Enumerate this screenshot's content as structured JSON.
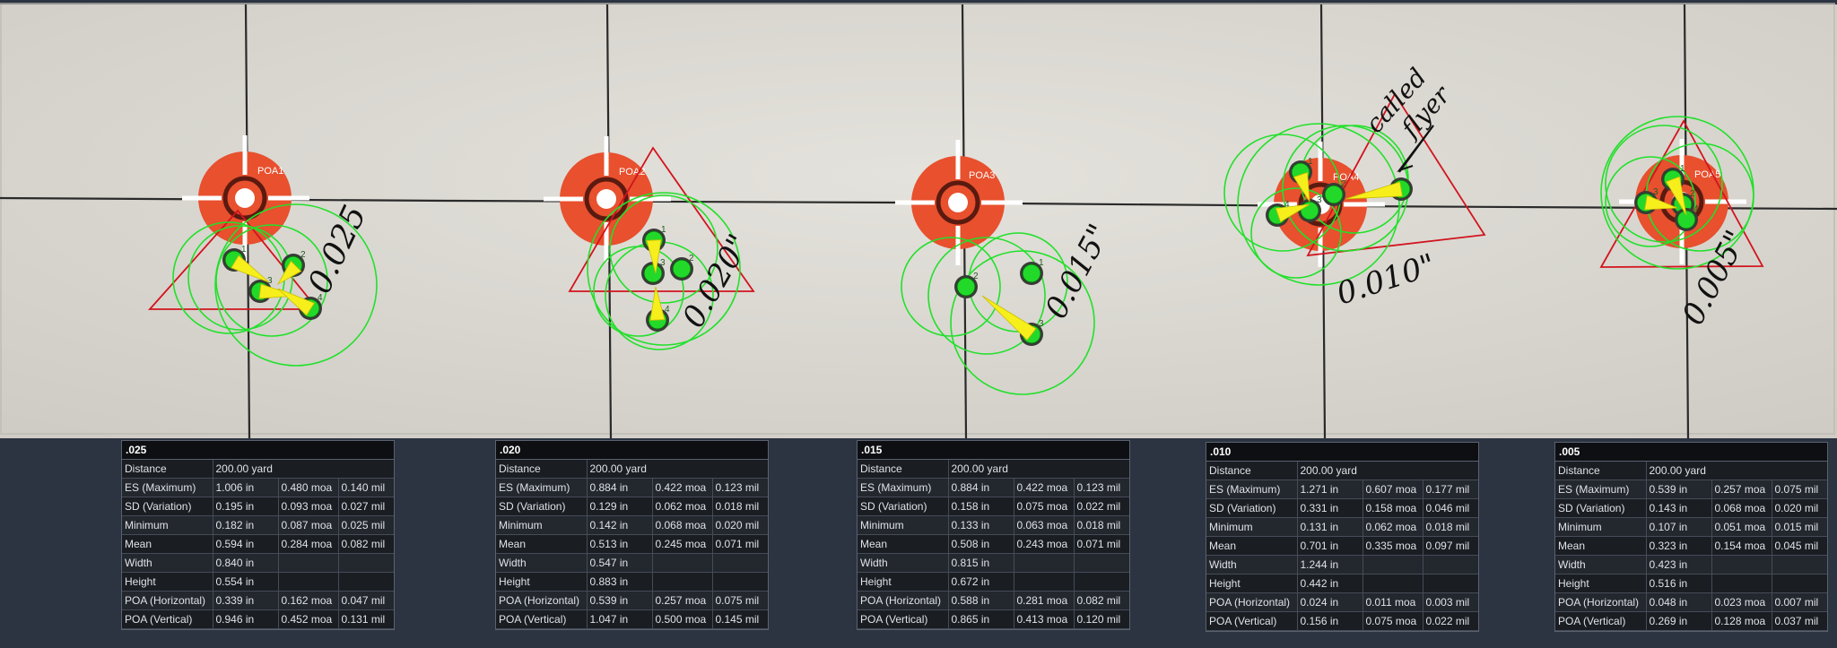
{
  "photo": {
    "targets": [
      {
        "poa_label": "POA1",
        "group_label": "0.025",
        "shot_numbers": [
          "1",
          "2",
          "3",
          "4"
        ]
      },
      {
        "poa_label": "POA2",
        "group_label": "0.020\"",
        "shot_numbers": [
          "1",
          "2",
          "3",
          "4"
        ]
      },
      {
        "poa_label": "POA3",
        "group_label": "0.015\"",
        "shot_numbers": [
          "1",
          "2",
          "3"
        ]
      },
      {
        "poa_label": "POA4",
        "group_label": "0.010\"",
        "shot_numbers": [
          "1",
          "2",
          "3",
          "4"
        ],
        "note": "called flyer"
      },
      {
        "poa_label": "POA5",
        "group_label": "0.005\"",
        "shot_numbers": [
          "1",
          "2",
          "3",
          "4"
        ]
      }
    ]
  },
  "panels": [
    {
      "title": ".025",
      "rows": [
        [
          "Distance",
          "200.00 yard"
        ],
        [
          "ES (Maximum)",
          "1.006 in",
          "0.480 moa",
          "0.140 mil"
        ],
        [
          "SD (Variation)",
          "0.195 in",
          "0.093 moa",
          "0.027 mil"
        ],
        [
          "Minimum",
          "0.182 in",
          "0.087 moa",
          "0.025 mil"
        ],
        [
          "Mean",
          "0.594 in",
          "0.284 moa",
          "0.082 mil"
        ],
        [
          "Width",
          "0.840 in"
        ],
        [
          "Height",
          "0.554 in"
        ],
        [
          "POA (Horizontal)",
          "0.339 in",
          "0.162 moa",
          "0.047 mil"
        ],
        [
          "POA (Vertical)",
          "0.946 in",
          "0.452 moa",
          "0.131 mil"
        ]
      ]
    },
    {
      "title": ".020",
      "rows": [
        [
          "Distance",
          "200.00 yard"
        ],
        [
          "ES (Maximum)",
          "0.884 in",
          "0.422 moa",
          "0.123 mil"
        ],
        [
          "SD (Variation)",
          "0.129 in",
          "0.062 moa",
          "0.018 mil"
        ],
        [
          "Minimum",
          "0.142 in",
          "0.068 moa",
          "0.020 mil"
        ],
        [
          "Mean",
          "0.513 in",
          "0.245 moa",
          "0.071 mil"
        ],
        [
          "Width",
          "0.547 in"
        ],
        [
          "Height",
          "0.883 in"
        ],
        [
          "POA (Horizontal)",
          "0.539 in",
          "0.257 moa",
          "0.075 mil"
        ],
        [
          "POA (Vertical)",
          "1.047 in",
          "0.500 moa",
          "0.145 mil"
        ]
      ]
    },
    {
      "title": ".015",
      "rows": [
        [
          "Distance",
          "200.00 yard"
        ],
        [
          "ES (Maximum)",
          "0.884 in",
          "0.422 moa",
          "0.123 mil"
        ],
        [
          "SD (Variation)",
          "0.158 in",
          "0.075 moa",
          "0.022 mil"
        ],
        [
          "Minimum",
          "0.133 in",
          "0.063 moa",
          "0.018 mil"
        ],
        [
          "Mean",
          "0.508 in",
          "0.243 moa",
          "0.071 mil"
        ],
        [
          "Width",
          "0.815 in"
        ],
        [
          "Height",
          "0.672 in"
        ],
        [
          "POA (Horizontal)",
          "0.588 in",
          "0.281 moa",
          "0.082 mil"
        ],
        [
          "POA (Vertical)",
          "0.865 in",
          "0.413 moa",
          "0.120 mil"
        ]
      ]
    },
    {
      "title": ".010",
      "rows": [
        [
          "Distance",
          "200.00 yard"
        ],
        [
          "ES (Maximum)",
          "1.271 in",
          "0.607 moa",
          "0.177 mil"
        ],
        [
          "SD (Variation)",
          "0.331 in",
          "0.158 moa",
          "0.046 mil"
        ],
        [
          "Minimum",
          "0.131 in",
          "0.062 moa",
          "0.018 mil"
        ],
        [
          "Mean",
          "0.701 in",
          "0.335 moa",
          "0.097 mil"
        ],
        [
          "Width",
          "1.244 in"
        ],
        [
          "Height",
          "0.442 in"
        ],
        [
          "POA (Horizontal)",
          "0.024 in",
          "0.011 moa",
          "0.003 mil"
        ],
        [
          "POA (Vertical)",
          "0.156 in",
          "0.075 moa",
          "0.022 mil"
        ]
      ]
    },
    {
      "title": ".005",
      "rows": [
        [
          "Distance",
          "200.00 yard"
        ],
        [
          "ES (Maximum)",
          "0.539 in",
          "0.257 moa",
          "0.075 mil"
        ],
        [
          "SD (Variation)",
          "0.143 in",
          "0.068 moa",
          "0.020 mil"
        ],
        [
          "Minimum",
          "0.107 in",
          "0.051 moa",
          "0.015 mil"
        ],
        [
          "Mean",
          "0.323 in",
          "0.154 moa",
          "0.045 mil"
        ],
        [
          "Width",
          "0.423 in"
        ],
        [
          "Height",
          "0.516 in"
        ],
        [
          "POA (Horizontal)",
          "0.048 in",
          "0.023 moa",
          "0.007 mil"
        ],
        [
          "POA (Vertical)",
          "0.269 in",
          "0.128 moa",
          "0.037 mil"
        ]
      ]
    }
  ]
}
